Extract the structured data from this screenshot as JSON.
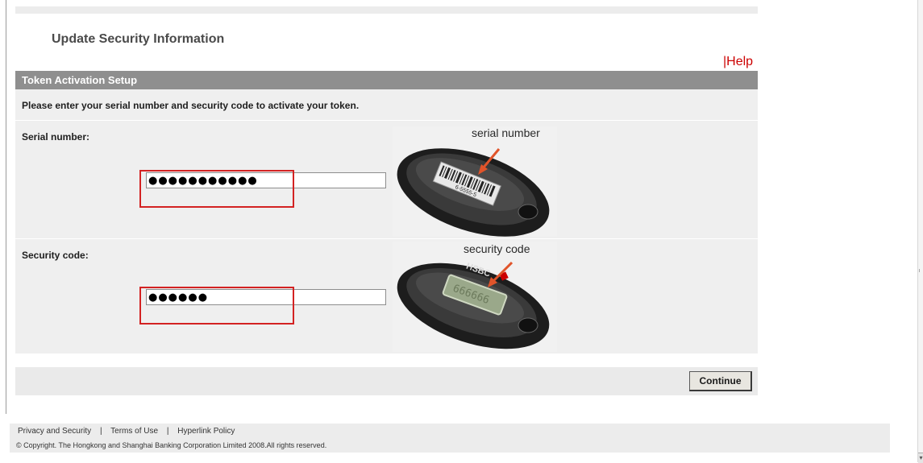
{
  "page": {
    "title": "Update Security Information",
    "help_separator": "|",
    "help_label": "Help"
  },
  "section": {
    "header": "Token Activation Setup",
    "instruction": "Please enter your serial number and security code to activate your token."
  },
  "fields": {
    "serial": {
      "label": "Serial number:",
      "value": "●●●●●●●●●●●"
    },
    "security": {
      "label": "Security code:",
      "value": "●●●●●●"
    }
  },
  "token_images": {
    "serial_caption": "serial number",
    "serial_barcode_text": "6-5555-5",
    "security_caption": "security code",
    "security_brand": "HSBC",
    "security_display": "666666"
  },
  "actions": {
    "continue_label": "Continue"
  },
  "footer": {
    "links": [
      "Privacy and Security",
      "Terms of Use",
      "Hyperlink Policy"
    ],
    "separator": "|",
    "copyright": "© Copyright. The Hongkong and Shanghai Banking Corporation Limited 2008.All rights reserved."
  },
  "colors": {
    "accent_red": "#cc0000",
    "header_gray": "#8f8f8f",
    "panel_gray": "#efefef"
  }
}
